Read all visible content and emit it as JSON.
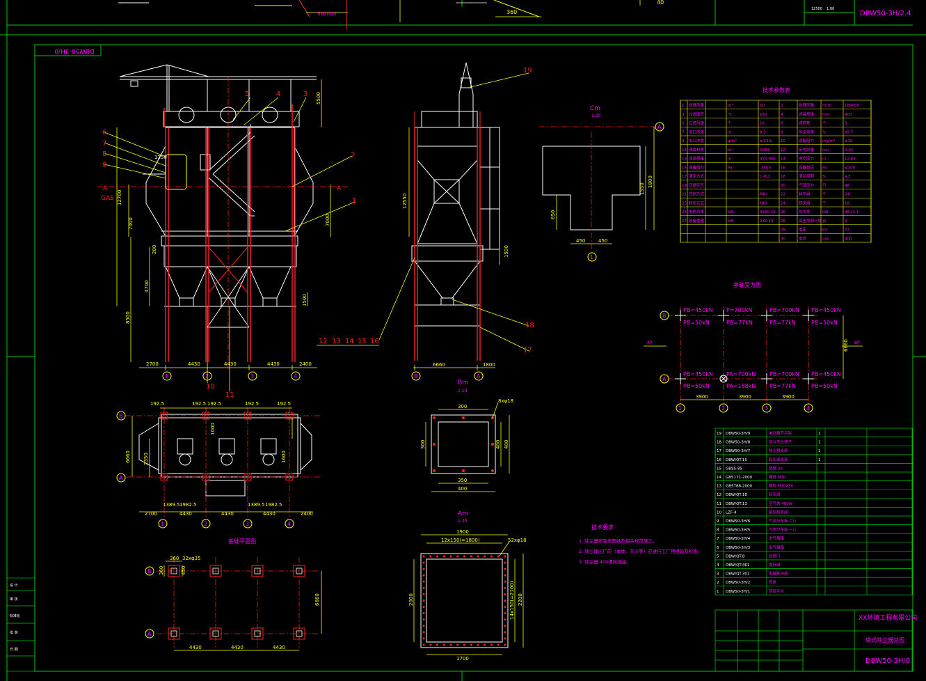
{
  "colors": {
    "background": "#000000",
    "frame": "#00c800",
    "structure": "#ffffff",
    "centerline": "#ff2020",
    "dimension": "#ffff00",
    "annotation": "#ff00ff",
    "leader": "#ff3030"
  },
  "titles": {
    "top_code": "DBW50-3H/2.4",
    "mirror_code": "DBW50-3H/0",
    "bottom_code": "DBW50-3H/0",
    "company": "XX环境工程有限公司",
    "drawing_name": "袋式除尘器总图",
    "params_title": "技术参数表",
    "notes_title": "技术要求",
    "loads_title": "基础受力图",
    "foundation_title": "基础平面图",
    "view_c": "Cm",
    "view_c_scale": "1:20",
    "view_b": "Bm",
    "view_b_scale": "1:10",
    "view_a": "Am",
    "view_a_scale": "1:20",
    "gas_label": "GAS",
    "section_a": "A"
  },
  "balloons": [
    "1",
    "2",
    "3",
    "4",
    "5",
    "6",
    "7",
    "8",
    "9",
    "10",
    "11",
    "12",
    "13",
    "14",
    "15",
    "16",
    "17",
    "18",
    "19"
  ],
  "axes": {
    "front": [
      "1",
      "2",
      "3",
      "4"
    ],
    "side": [
      "B",
      "A"
    ],
    "loads_cols": [
      "1",
      "2",
      "3",
      "4"
    ],
    "loads_rows": [
      "B",
      "A"
    ]
  },
  "dims": {
    "front_bottom": [
      "2700",
      "4430",
      "4430",
      "4430",
      "2400"
    ],
    "front_left": [
      "12700",
      "7000",
      "200",
      "4700",
      "8500"
    ],
    "front_right": [
      "5500",
      "7000",
      "1500"
    ],
    "front_top_note": "1350",
    "side_left": "12550",
    "side_right": "1500",
    "side_bottom": [
      "6660",
      "1800"
    ],
    "plan_top": [
      "192.5",
      "192.5",
      "192.5",
      "192.5",
      "192.5"
    ],
    "plan_bottom": [
      "2700",
      "4430",
      "4430",
      "4430",
      "2400"
    ],
    "plan_inner": [
      "1389.5",
      "1982.5",
      "1389.5",
      "1982.5"
    ],
    "plan_left": [
      "6660",
      "2350"
    ],
    "plan_right": [
      "1000",
      "1600"
    ],
    "view_c_right": [
      "1550",
      "1800"
    ],
    "view_c_left": "650",
    "view_c_bottom": [
      "450",
      "450"
    ],
    "view_b_top": "300",
    "view_b_side": [
      "300",
      "400",
      "400"
    ],
    "view_b_bottom": [
      "350",
      "400"
    ],
    "view_b_hole": "8xφ18",
    "view_a_top": [
      "1900",
      "12x150(=1800)"
    ],
    "view_a_hole": "52xφ18",
    "view_a_side": [
      "2000",
      "14x150(=2100)",
      "2200"
    ],
    "view_a_bottom": "1700",
    "found_top": [
      "360",
      "32xφ35"
    ],
    "found_small": [
      "450",
      "360"
    ],
    "found_right": "6660",
    "found_bottom": [
      "4430",
      "4430",
      "4430"
    ],
    "loads_bottom": [
      "3900",
      "3900",
      "3900"
    ],
    "loads_right": "6660",
    "top_strip": [
      "360",
      "40",
      "500(00)"
    ]
  },
  "loads": {
    "row_b": [
      {
        "p": "PB=450kN",
        "s": "PB=50kN"
      },
      {
        "p": "P=700kN",
        "s": "PB=77kN"
      },
      {
        "p": "PB=700kN",
        "s": "PB=77kN"
      },
      {
        "p": "PB=450kN",
        "s": "PB=50kN"
      }
    ],
    "row_a": [
      {
        "p": "PB=450kN",
        "s": "PB=50kN"
      },
      {
        "p": "PA=700kN",
        "s": "PA=188kN"
      },
      {
        "p": "PB=700kN",
        "s": "PB=77kN"
      },
      {
        "p": "PB=450kN",
        "s": "PB=50kN"
      }
    ],
    "left_arrow": "XP",
    "right_arrow": "BP"
  },
  "params": {
    "rows": [
      [
        "1",
        "处理风量",
        "m³",
        "50",
        "2",
        "处理风量",
        "m³/h",
        "169000"
      ],
      [
        "3",
        "过滤面积",
        "℃",
        "150",
        "4",
        "滤袋规格",
        "mm",
        "400"
      ],
      [
        "5",
        "过滤风速",
        "个",
        "16",
        "6",
        "滤袋数",
        "个",
        "3"
      ],
      [
        "7",
        "进口浓度",
        "m",
        "8.3",
        "8",
        "除尘效率",
        "%",
        "99.7"
      ],
      [
        "9",
        "出口浓度",
        "g/m³",
        "≤1.19",
        "10",
        "设备阻力",
        "mg/m³",
        "≤30"
      ],
      [
        "11",
        "滤袋材质",
        "m²",
        "2981",
        "12",
        "反吹风量",
        "m/s",
        "0.94"
      ],
      [
        "13",
        "滤袋规格",
        "m",
        "3X3.965",
        "14",
        "喷吹压力",
        "m",
        "12.69"
      ],
      [
        "15",
        "设备阻力",
        "Pa",
        "-3500",
        "16",
        "设备耐压",
        "Pa",
        "≤300"
      ],
      [
        "17",
        "清灰方式",
        "",
        "C-PLC",
        "18",
        "清灰周期",
        "%",
        "≤3"
      ],
      [
        "19",
        "压缩空气",
        "",
        "",
        "20",
        "气源压力",
        "只",
        "48"
      ],
      [
        "21",
        "控制方式",
        "",
        "MKI",
        "22",
        "脉冲阀",
        "个",
        "24"
      ],
      [
        "23",
        "卸灰方式",
        "",
        "MKI",
        "24",
        "卸灰阀",
        "个",
        "18"
      ],
      [
        "25",
        "电机功率",
        "kW",
        "42X0.15",
        "26",
        "总功率",
        "kW",
        "48+1.1"
      ],
      [
        "27",
        "设备重量",
        "kW",
        "3X0.15",
        "28",
        "高压电源一件",
        "台",
        "3"
      ],
      [
        "",
        "",
        "",
        "",
        "29",
        "电压",
        "kV",
        "72"
      ],
      [
        "",
        "",
        "",
        "",
        "30",
        "电流",
        "mA",
        "400"
      ]
    ]
  },
  "notes": [
    "1.  除尘器安装按图纸及相关规范施工。",
    "2.  除尘器出厂前（本体、灰斗等）应进行工厂预组装及检查。",
    "3.  除尘器 400螺栓连接。"
  ],
  "bom": [
    [
      "19",
      "DBW50-3H/9",
      "电动葫芦吊架",
      "1",
      ""
    ],
    [
      "18",
      "DBW50-3H/8",
      "灰斗平台梯子",
      "1",
      ""
    ],
    [
      "17",
      "DBW50-3H/7",
      "除尘器支架",
      "1",
      ""
    ],
    [
      "16",
      "DBW/QT.15",
      "卸灰阀支架",
      "1",
      ""
    ],
    [
      "15",
      "GB95-85",
      "垫圈 30",
      "",
      ""
    ],
    [
      "14",
      "GB5171-2000",
      "螺母 M30",
      "",
      ""
    ],
    [
      "13",
      "GB5788-2000",
      "螺栓 M30X90",
      "",
      ""
    ],
    [
      "12",
      "DBW/QT.16",
      "卸灰阀",
      "",
      ""
    ],
    [
      "11",
      "DBW/QT.13",
      "空气炮 48kW",
      "",
      ""
    ],
    [
      "10",
      "LZF-4",
      "星形卸灰阀",
      "",
      ""
    ],
    [
      "9",
      "DBW50-3H/6",
      "气流分布板 二()",
      "",
      ""
    ],
    [
      "8",
      "DBW50-3H/5",
      "气流分布板 一()",
      "",
      ""
    ],
    [
      "7",
      "DBW50-3H/4",
      "进气烟箱",
      "",
      ""
    ],
    [
      "6",
      "DBW50-3H/3",
      "出气烟箱",
      "",
      ""
    ],
    [
      "5",
      "DBW/QT.8",
      "检修门",
      "",
      ""
    ],
    [
      "4",
      "DBW/QT.461",
      "提升阀",
      "",
      ""
    ],
    [
      "3",
      "DBW/QT.301",
      "电磁脉冲阀",
      "",
      ""
    ],
    [
      "2",
      "DBW50-3H/2",
      "壳体",
      "",
      ""
    ],
    [
      "1",
      "DBW50-3H/1",
      "顶部平台",
      "",
      ""
    ]
  ],
  "left_strip": [
    "设  计",
    "审  核",
    "标准化",
    "批  准",
    "日  期"
  ],
  "top_block": [
    "12500",
    "1:80"
  ]
}
